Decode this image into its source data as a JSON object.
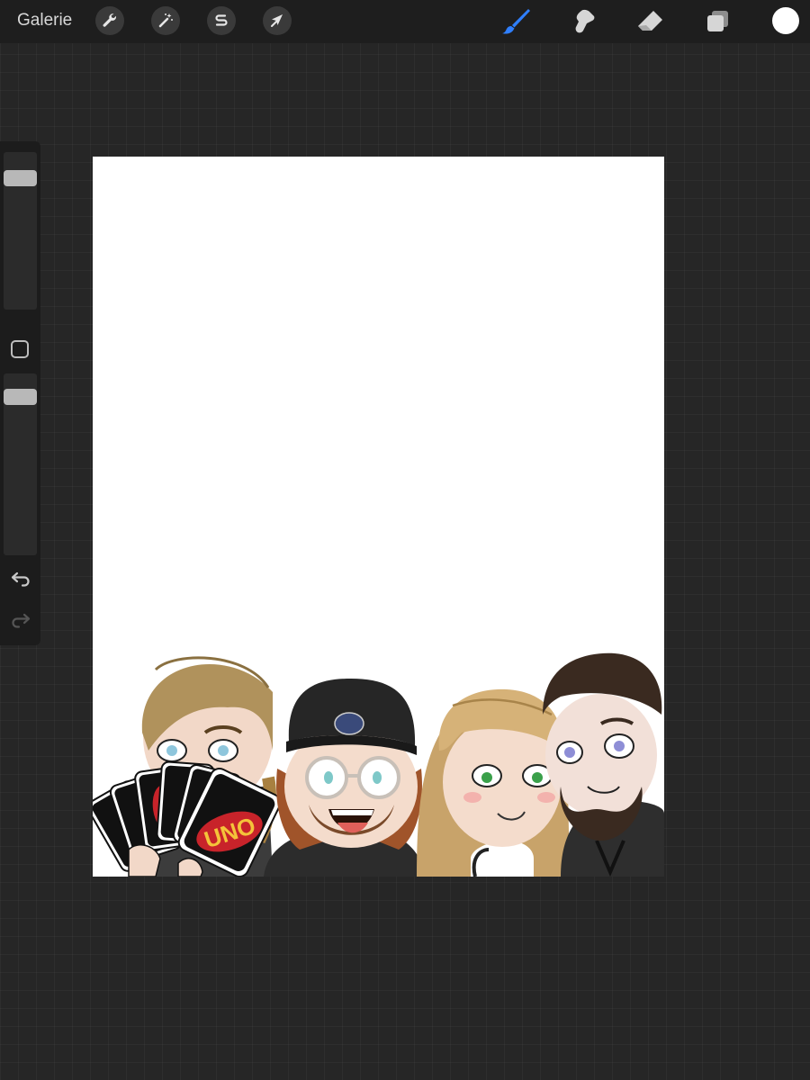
{
  "topbar": {
    "gallery_label": "Galerie",
    "left_tools": [
      {
        "name": "actions-wrench-icon"
      },
      {
        "name": "adjustments-magic-wand-icon"
      },
      {
        "name": "selection-s-icon"
      },
      {
        "name": "transform-arrow-icon"
      }
    ],
    "right_tools": [
      {
        "name": "brush-icon",
        "active": true,
        "color": "#2f7fff"
      },
      {
        "name": "smudge-icon"
      },
      {
        "name": "eraser-icon"
      },
      {
        "name": "layers-icon"
      }
    ],
    "current_color": "#ffffff"
  },
  "sidebar": {
    "brush_size_level": 0.05,
    "opacity_level": 0.06
  },
  "artwork": {
    "card_text": "UNO",
    "characters": [
      "blond-man",
      "beanie-man",
      "blonde-woman",
      "bearded-man"
    ]
  }
}
